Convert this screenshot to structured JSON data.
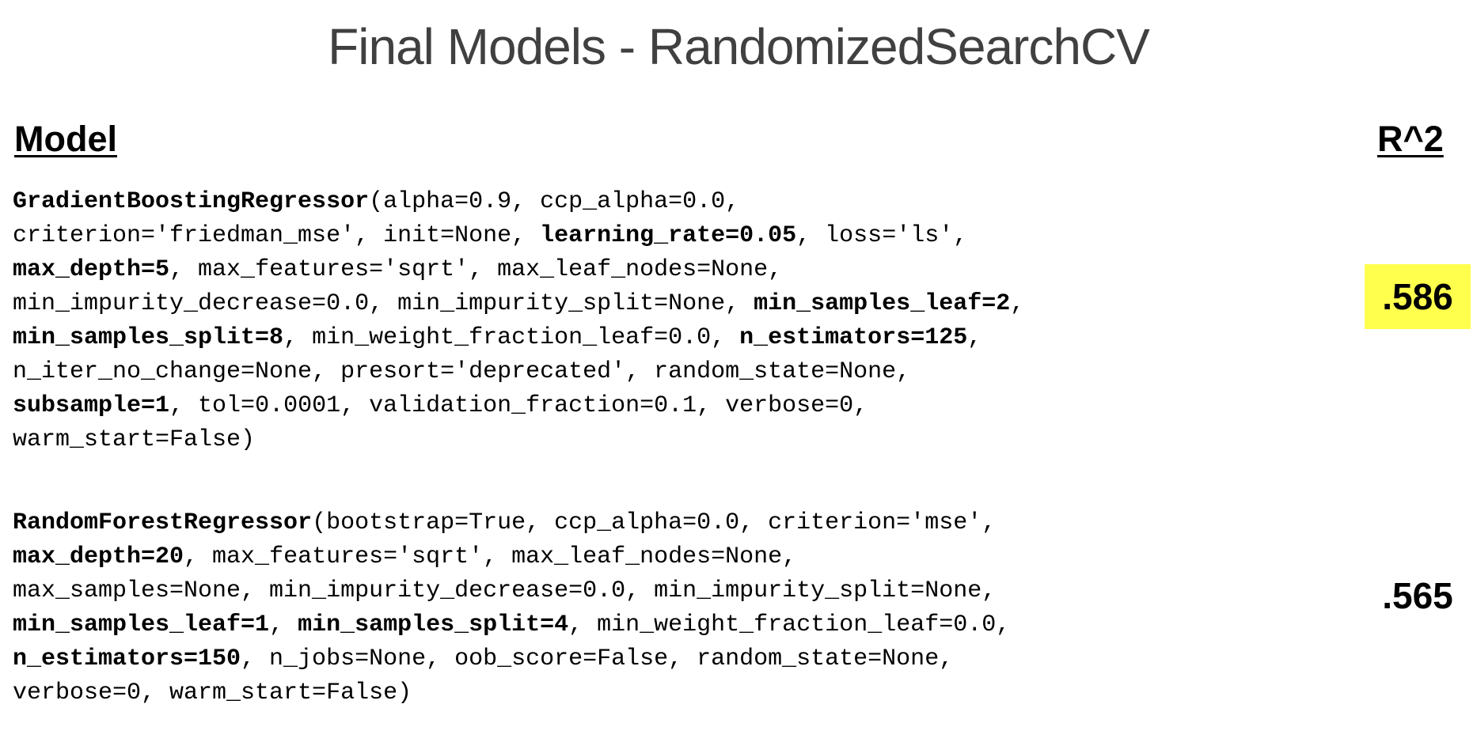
{
  "title": "Final Models - RandomizedSearchCV",
  "headers": {
    "model": "Model",
    "metric": "R^2"
  },
  "highlight_color": "#ffff4d",
  "models": [
    {
      "name": "GradientBoostingRegressor",
      "score": ".586",
      "score_highlighted": true,
      "lines": [
        [
          {
            "text": "GradientBoostingRegressor",
            "bold": true
          },
          {
            "text": "(alpha=0.9, ccp_alpha=0.0,",
            "bold": false
          }
        ],
        [
          {
            "text": "criterion='friedman_mse', init=None, ",
            "bold": false
          },
          {
            "text": "learning_rate=0.05",
            "bold": true
          },
          {
            "text": ", loss='ls',",
            "bold": false
          }
        ],
        [
          {
            "text": "max_depth=5",
            "bold": true
          },
          {
            "text": ", max_features='sqrt', max_leaf_nodes=None,",
            "bold": false
          }
        ],
        [
          {
            "text": "min_impurity_decrease=0.0, min_impurity_split=None, ",
            "bold": false
          },
          {
            "text": "min_samples_leaf=2",
            "bold": true
          },
          {
            "text": ",",
            "bold": false
          }
        ],
        [
          {
            "text": "min_samples_split=8",
            "bold": true
          },
          {
            "text": ", min_weight_fraction_leaf=0.0, ",
            "bold": false
          },
          {
            "text": "n_estimators=125",
            "bold": true
          },
          {
            "text": ",",
            "bold": false
          }
        ],
        [
          {
            "text": "n_iter_no_change=None, presort='deprecated', random_state=None,",
            "bold": false
          }
        ],
        [
          {
            "text": "subsample=1",
            "bold": true
          },
          {
            "text": ", tol=0.0001, validation_fraction=0.1, verbose=0,",
            "bold": false
          }
        ],
        [
          {
            "text": "warm_start=False)",
            "bold": false
          }
        ]
      ]
    },
    {
      "name": "RandomForestRegressor",
      "score": ".565",
      "score_highlighted": false,
      "lines": [
        [
          {
            "text": "RandomForestRegressor",
            "bold": true
          },
          {
            "text": "(bootstrap=True, ccp_alpha=0.0, criterion='mse',",
            "bold": false
          }
        ],
        [
          {
            "text": "max_depth=20",
            "bold": true
          },
          {
            "text": ", max_features='sqrt', max_leaf_nodes=None,",
            "bold": false
          }
        ],
        [
          {
            "text": "max_samples=None, min_impurity_decrease=0.0, min_impurity_split=None,",
            "bold": false
          }
        ],
        [
          {
            "text": "min_samples_leaf=1",
            "bold": true
          },
          {
            "text": ", ",
            "bold": false
          },
          {
            "text": "min_samples_split=4",
            "bold": true
          },
          {
            "text": ", min_weight_fraction_leaf=0.0,",
            "bold": false
          }
        ],
        [
          {
            "text": "n_estimators=150",
            "bold": true
          },
          {
            "text": ", n_jobs=None, oob_score=False, random_state=None,",
            "bold": false
          }
        ],
        [
          {
            "text": "verbose=0, warm_start=False)",
            "bold": false
          }
        ]
      ]
    }
  ]
}
